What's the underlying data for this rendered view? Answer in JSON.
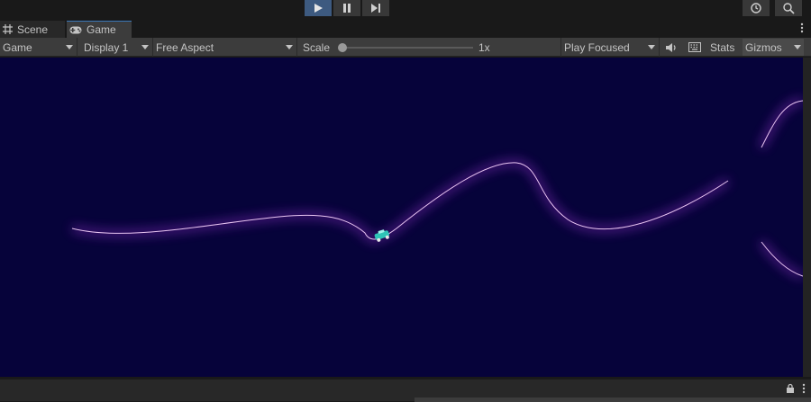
{
  "toolbar": {
    "buttons": [
      "play",
      "pause",
      "step"
    ],
    "right_icons": [
      "history-icon",
      "search-icon"
    ]
  },
  "tabs": [
    {
      "label": "Scene",
      "icon": "grid-icon"
    },
    {
      "label": "Game",
      "icon": "gamepad-icon"
    }
  ],
  "game_toolbar": {
    "view_mode": "Game",
    "display": "Display 1",
    "aspect": "Free Aspect",
    "scale_label": "Scale",
    "scale_value": "1x",
    "scale_fraction": 0.0,
    "play_mode": "Play Focused",
    "stats_label": "Stats",
    "gizmos_label": "Gizmos"
  },
  "colors": {
    "game_background": "#06033a",
    "track": "#e8c6f2",
    "glow": "#8a2bbf",
    "vehicle": "#2ec4b6",
    "accent": "#3a79bb"
  }
}
